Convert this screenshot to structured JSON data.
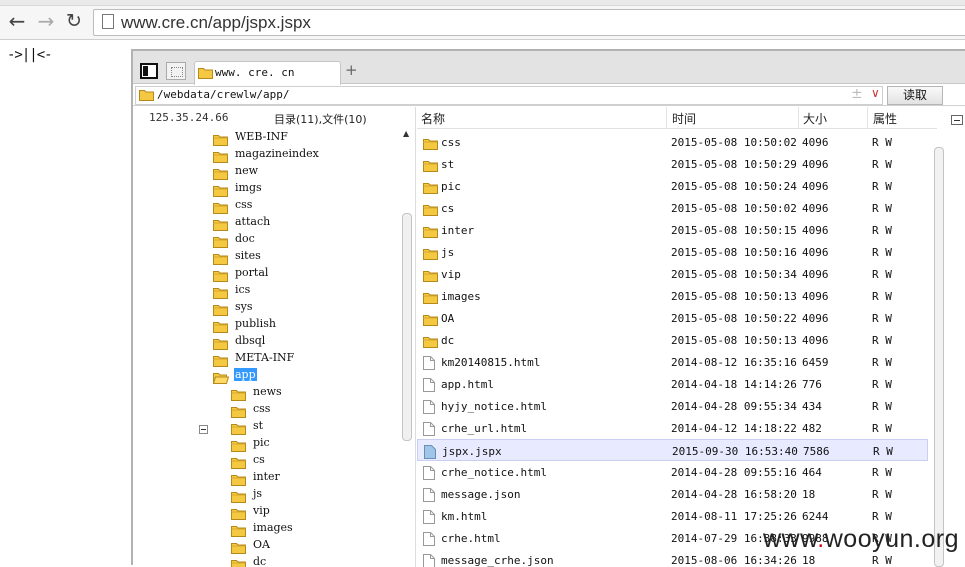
{
  "browser": {
    "url": "www.cre.cn/app/jspx.jspx"
  },
  "page": {
    "marker_text": "->||<-"
  },
  "tabs": [
    {
      "label": "www. cre. cn"
    }
  ],
  "path_bar": {
    "value": "/webdata/crewlw/app/",
    "fav_symbol": "±",
    "dropdown_symbol": "∨",
    "read_label": "读取"
  },
  "left_panel": {
    "ip": "125.35.24.66",
    "summary": "目录(11),文件(10)",
    "scroll_up": "▲",
    "tree": [
      {
        "name": "WEB-INF",
        "level": 0
      },
      {
        "name": "magazineindex",
        "level": 0
      },
      {
        "name": "new",
        "level": 0
      },
      {
        "name": "imgs",
        "level": 0
      },
      {
        "name": "css",
        "level": 0
      },
      {
        "name": "attach",
        "level": 0
      },
      {
        "name": "doc",
        "level": 0
      },
      {
        "name": "sites",
        "level": 0
      },
      {
        "name": "portal",
        "level": 0
      },
      {
        "name": "ics",
        "level": 0
      },
      {
        "name": "sys",
        "level": 0
      },
      {
        "name": "publish",
        "level": 0
      },
      {
        "name": "dbsql",
        "level": 0
      },
      {
        "name": "META-INF",
        "level": 0
      },
      {
        "name": "app",
        "level": 0,
        "selected": true,
        "open": true
      },
      {
        "name": "news",
        "level": 1
      },
      {
        "name": "css",
        "level": 1
      },
      {
        "name": "st",
        "level": 1
      },
      {
        "name": "pic",
        "level": 1
      },
      {
        "name": "cs",
        "level": 1
      },
      {
        "name": "inter",
        "level": 1
      },
      {
        "name": "js",
        "level": 1
      },
      {
        "name": "vip",
        "level": 1
      },
      {
        "name": "images",
        "level": 1
      },
      {
        "name": "OA",
        "level": 1
      },
      {
        "name": "dc",
        "level": 1
      }
    ]
  },
  "file_list": {
    "headers": {
      "name": "名称",
      "time": "时间",
      "size": "大小",
      "attr": "属性"
    },
    "rows": [
      {
        "type": "folder",
        "name": "css",
        "time": "2015-05-08 10:50:02",
        "size": "4096",
        "attr": "R W"
      },
      {
        "type": "folder",
        "name": "st",
        "time": "2015-05-08 10:50:29",
        "size": "4096",
        "attr": "R W"
      },
      {
        "type": "folder",
        "name": "pic",
        "time": "2015-05-08 10:50:24",
        "size": "4096",
        "attr": "R W"
      },
      {
        "type": "folder",
        "name": "cs",
        "time": "2015-05-08 10:50:02",
        "size": "4096",
        "attr": "R W"
      },
      {
        "type": "folder",
        "name": "inter",
        "time": "2015-05-08 10:50:15",
        "size": "4096",
        "attr": "R W"
      },
      {
        "type": "folder",
        "name": "js",
        "time": "2015-05-08 10:50:16",
        "size": "4096",
        "attr": "R W"
      },
      {
        "type": "folder",
        "name": "vip",
        "time": "2015-05-08 10:50:34",
        "size": "4096",
        "attr": "R W"
      },
      {
        "type": "folder",
        "name": "images",
        "time": "2015-05-08 10:50:13",
        "size": "4096",
        "attr": "R W"
      },
      {
        "type": "folder",
        "name": "OA",
        "time": "2015-05-08 10:50:22",
        "size": "4096",
        "attr": "R W"
      },
      {
        "type": "folder",
        "name": "dc",
        "time": "2015-05-08 10:50:13",
        "size": "4096",
        "attr": "R W"
      },
      {
        "type": "file",
        "name": "km20140815.html",
        "time": "2014-08-12 16:35:16",
        "size": "6459",
        "attr": "R W"
      },
      {
        "type": "file",
        "name": "app.html",
        "time": "2014-04-18 14:14:26",
        "size": "776",
        "attr": "R W"
      },
      {
        "type": "file",
        "name": "hyjy_notice.html",
        "time": "2014-04-28 09:55:34",
        "size": "434",
        "attr": "R W"
      },
      {
        "type": "file",
        "name": "crhe_url.html",
        "time": "2014-04-12 14:18:22",
        "size": "482",
        "attr": "R W"
      },
      {
        "type": "file-selected",
        "name": "jspx.jspx",
        "time": "2015-09-30 16:53:40",
        "size": "7586",
        "attr": "R W",
        "selected": true
      },
      {
        "type": "file",
        "name": "crhe_notice.html",
        "time": "2014-04-28 09:55:16",
        "size": "464",
        "attr": "R W"
      },
      {
        "type": "file",
        "name": "message.json",
        "time": "2014-04-28 16:58:20",
        "size": "18",
        "attr": "R W"
      },
      {
        "type": "file",
        "name": "km.html",
        "time": "2014-08-11 17:25:26",
        "size": "6244",
        "attr": "R W"
      },
      {
        "type": "file",
        "name": "crhe.html",
        "time": "2014-07-29 16:38:33",
        "size": "9988",
        "attr": "R W"
      },
      {
        "type": "file",
        "name": "message_crhe.json",
        "time": "2015-08-06 16:34:26",
        "size": "18",
        "attr": "R W"
      }
    ]
  },
  "watermark": {
    "prefix": "www",
    "dot": ".",
    "middle": "wooyun",
    "suffix": "org"
  },
  "colors": {
    "selection": "#3399ff",
    "folder": "#f5c842",
    "watermark_dot": "#e3001b"
  }
}
